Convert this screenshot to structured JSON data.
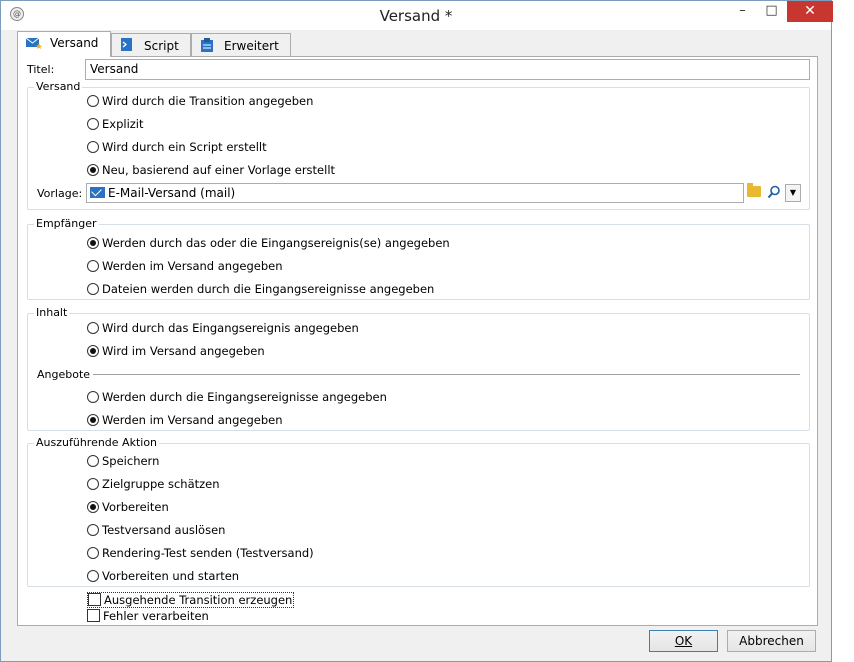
{
  "window": {
    "title": "Versand *",
    "minimize": "–",
    "maximize": "□",
    "close": "✕"
  },
  "tabs": [
    {
      "label": "Versand",
      "icon": "envelope-star-icon",
      "active": true
    },
    {
      "label": "Script",
      "icon": "script-icon",
      "active": false
    },
    {
      "label": "Erweitert",
      "icon": "clipboard-icon",
      "active": false
    }
  ],
  "title_field": {
    "label": "Titel:",
    "value": "Versand"
  },
  "versand_group": {
    "title": "Versand",
    "options": [
      {
        "label": "Wird durch die Transition angegeben",
        "selected": false
      },
      {
        "label": "Explizit",
        "selected": false
      },
      {
        "label": "Wird durch ein Script erstellt",
        "selected": false
      },
      {
        "label": "Neu, basierend auf einer Vorlage erstellt",
        "selected": true
      }
    ],
    "template_label": "Vorlage:",
    "template_value": "E-Mail-Versand (mail)"
  },
  "empfaenger_group": {
    "title": "Empfänger",
    "options": [
      {
        "label": "Werden durch das oder die Eingangsereignis(se) angegeben",
        "selected": true
      },
      {
        "label": "Werden im Versand angegeben",
        "selected": false
      },
      {
        "label": "Dateien werden durch die Eingangsereignisse angegeben",
        "selected": false
      }
    ]
  },
  "inhalt_group": {
    "title": "Inhalt",
    "options": [
      {
        "label": "Wird durch das Eingangsereignis angegeben",
        "selected": false
      },
      {
        "label": "Wird im Versand angegeben",
        "selected": true
      }
    ],
    "angebote_title": "Angebote",
    "angebote_options": [
      {
        "label": "Werden durch die Eingangsereignisse angegeben",
        "selected": false
      },
      {
        "label": "Werden im Versand angegeben",
        "selected": true
      }
    ]
  },
  "aktion_group": {
    "title": "Auszuführende Aktion",
    "options": [
      {
        "label": "Speichern",
        "selected": false
      },
      {
        "label": "Zielgruppe schätzen",
        "selected": false
      },
      {
        "label": "Vorbereiten",
        "selected": true
      },
      {
        "label": "Testversand auslösen",
        "selected": false
      },
      {
        "label": "Rendering-Test senden (Testversand)",
        "selected": false
      },
      {
        "label": "Vorbereiten und starten",
        "selected": false
      }
    ]
  },
  "checkboxes": [
    {
      "label": "Ausgehende Transition erzeugen",
      "checked": false
    },
    {
      "label": "Fehler verarbeiten",
      "checked": false
    }
  ],
  "buttons": {
    "ok": "OK",
    "cancel": "Abbrechen"
  }
}
